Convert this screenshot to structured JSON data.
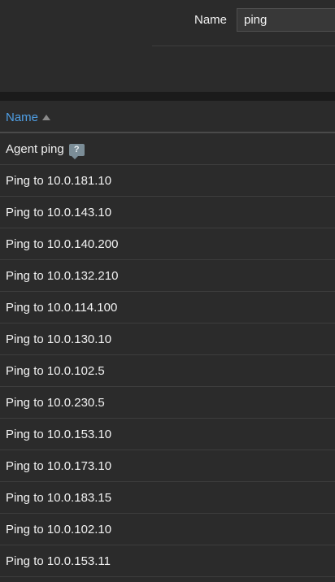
{
  "filter": {
    "label": "Name",
    "value": "ping"
  },
  "table": {
    "header": {
      "name_label": "Name",
      "sort": "ascending"
    },
    "rows": [
      {
        "name": "Agent ping",
        "has_help": true
      },
      {
        "name": "Ping to 10.0.181.10"
      },
      {
        "name": "Ping to 10.0.143.10"
      },
      {
        "name": "Ping to 10.0.140.200"
      },
      {
        "name": "Ping to 10.0.132.210"
      },
      {
        "name": "Ping to 10.0.114.100"
      },
      {
        "name": "Ping to 10.0.130.10"
      },
      {
        "name": "Ping to 10.0.102.5"
      },
      {
        "name": "Ping to 10.0.230.5"
      },
      {
        "name": "Ping to 10.0.153.10"
      },
      {
        "name": "Ping to 10.0.173.10"
      },
      {
        "name": "Ping to 10.0.183.15"
      },
      {
        "name": "Ping to 10.0.102.10"
      },
      {
        "name": "Ping to 10.0.153.11"
      }
    ]
  },
  "colors": {
    "background": "#2b2b2b",
    "link": "#4f9fe5",
    "text": "#f2f2f2",
    "help_icon": "#7b8d97"
  },
  "icons": {
    "help": "question-mark-icon",
    "help_glyph": "?",
    "sort": "sort-ascending-icon"
  }
}
